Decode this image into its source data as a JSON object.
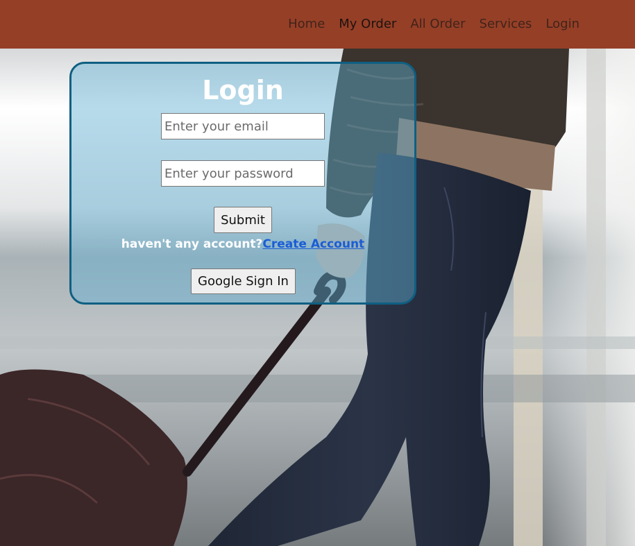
{
  "nav": {
    "items": [
      {
        "label": "Home",
        "active": false
      },
      {
        "label": "My Order",
        "active": true
      },
      {
        "label": "All Order",
        "active": false
      },
      {
        "label": "Services",
        "active": false
      },
      {
        "label": "Login",
        "active": false
      }
    ]
  },
  "login": {
    "title": "Login",
    "email_placeholder": "Enter your email",
    "email_value": "",
    "password_placeholder": "Enter your password",
    "password_value": "",
    "submit_label": "Submit",
    "no_account_text": "haven't any account?",
    "create_account_label": "Create Account",
    "google_label": "Google Sign In"
  },
  "colors": {
    "navbar": "#953f27",
    "card_border": "#0f5f82",
    "card_fill": "rgba(96,176,210,0.45)",
    "link": "#1a5dd6"
  }
}
